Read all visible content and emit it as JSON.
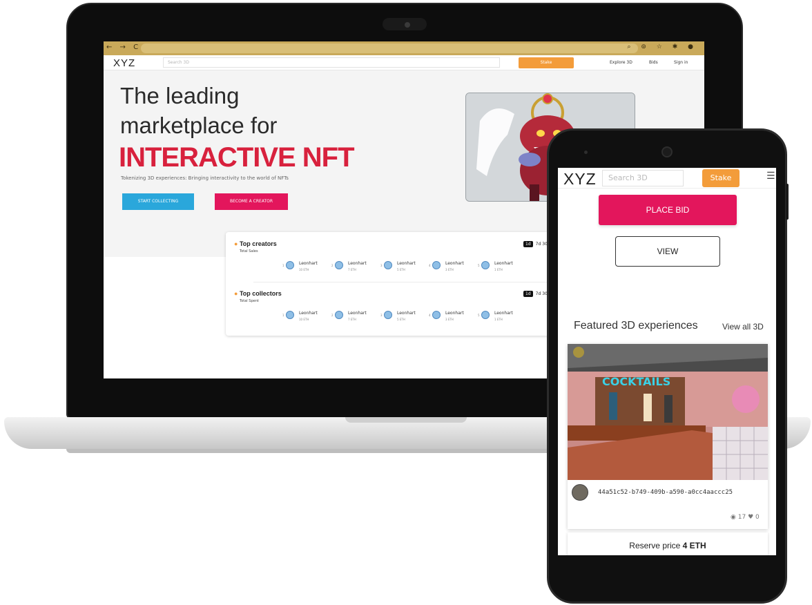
{
  "desktop": {
    "header": {
      "logo": "XYZ",
      "search_placeholder": "Search 3D",
      "stake_label": "Stake",
      "nav": [
        "Explore 3D",
        "Bids",
        "Sign in"
      ]
    },
    "hero": {
      "line1": "The leading",
      "line2": "marketplace for",
      "highlight": "INTERACTIVE NFT",
      "subtitle": "Tokenizing 3D experiences: Bringing interactivity to the world of NFTs",
      "collect_button": "START COLLECTING",
      "creator_button": "BECOME A CREATOR"
    },
    "top_creators": {
      "title": "Top creators",
      "subtitle": "Total Sales",
      "periods": [
        "1d",
        "7d",
        "30"
      ],
      "items": [
        {
          "rank": "1",
          "name": "Leonhart",
          "value": "10 ETH"
        },
        {
          "rank": "2",
          "name": "Leonhart",
          "value": "7 ETH"
        },
        {
          "rank": "3",
          "name": "Leonhart",
          "value": "5 ETH"
        },
        {
          "rank": "4",
          "name": "Leonhart",
          "value": "3 ETH"
        },
        {
          "rank": "5",
          "name": "Leonhart",
          "value": "1 ETH"
        }
      ]
    },
    "top_collectors": {
      "title": "Top collectors",
      "subtitle": "Total Spent",
      "periods": [
        "1d",
        "7d",
        "30"
      ],
      "items": [
        {
          "rank": "1",
          "name": "Leonhart",
          "value": "10 ETH"
        },
        {
          "rank": "2",
          "name": "Leonhart",
          "value": "7 ETH"
        },
        {
          "rank": "3",
          "name": "Leonhart",
          "value": "5 ETH"
        },
        {
          "rank": "4",
          "name": "Leonhart",
          "value": "3 ETH"
        },
        {
          "rank": "5",
          "name": "Leonhart",
          "value": "1 ETH"
        }
      ]
    }
  },
  "mobile": {
    "logo": "XYZ",
    "search_placeholder": "Search 3D",
    "stake_label": "Stake",
    "menu_icon": "hamburger-icon",
    "place_bid": "PLACE BID",
    "view": "VIEW",
    "featured_title": "Featured 3D experiences",
    "view_all": "View all 3D",
    "card": {
      "sign_text": "COCKTAILS",
      "nft_id": "44a51c52-b749-409b-a590-a0cc4aaccc25",
      "views": "17",
      "likes": "0"
    },
    "reserve_label": "Reserve price",
    "reserve_value": "4 ETH"
  },
  "colors": {
    "accent_pink": "#e3165c",
    "accent_red": "#d8213d",
    "accent_orange": "#f39c3a",
    "accent_blue": "#2aa7db"
  }
}
